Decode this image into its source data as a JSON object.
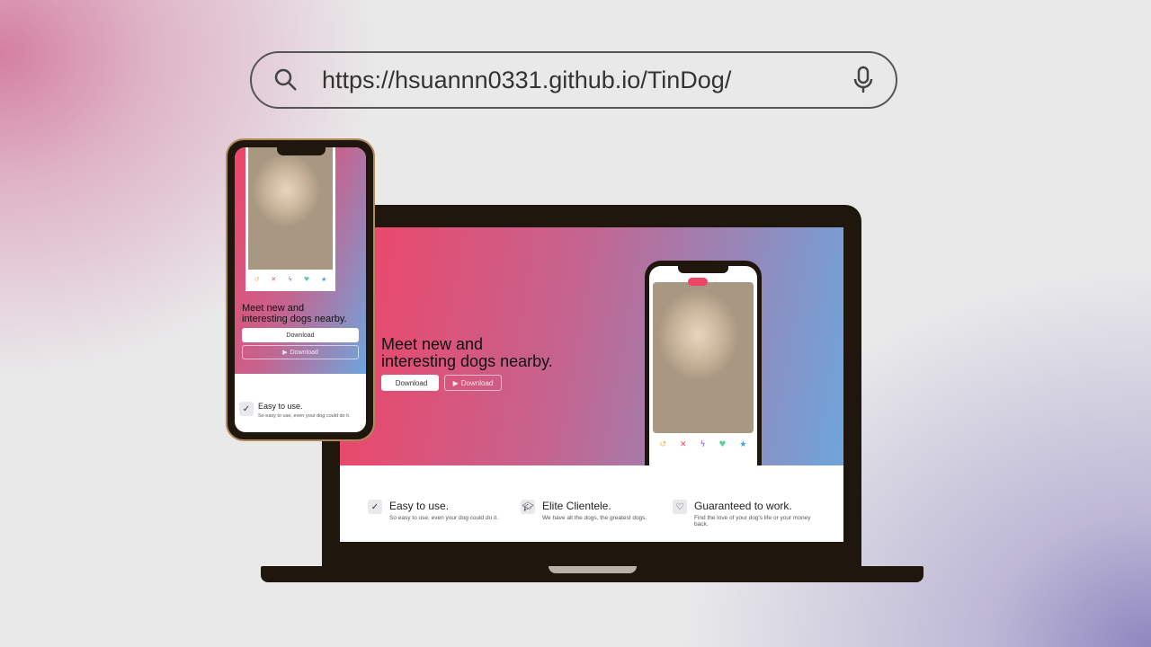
{
  "address_bar": {
    "url": "https://hsuannn0331.github.io/TinDog/",
    "search_icon": "search-icon",
    "mic_icon": "microphone-icon"
  },
  "site": {
    "headline_line1": "Meet new and",
    "headline_line2": "interesting dogs nearby.",
    "download_apple": "Download",
    "download_play": "Download",
    "features": [
      {
        "title": "Easy to use.",
        "desc": "So easy to use, even your dog could do it.",
        "icon": "check-circle-icon"
      },
      {
        "title": "Elite Clientele.",
        "desc": "We have all the dogs, the greatest dogs.",
        "icon": "graduation-cap-icon"
      },
      {
        "title": "Guaranteed to work.",
        "desc": "Find the love of your dog's life or your money back.",
        "icon": "heart-arrow-icon"
      }
    ],
    "action_icons": [
      "undo-icon",
      "x-icon",
      "bolt-icon",
      "heart-icon",
      "star-icon"
    ],
    "colors": {
      "gradient_start": "#f04466",
      "gradient_end": "#6ea5dc"
    }
  }
}
